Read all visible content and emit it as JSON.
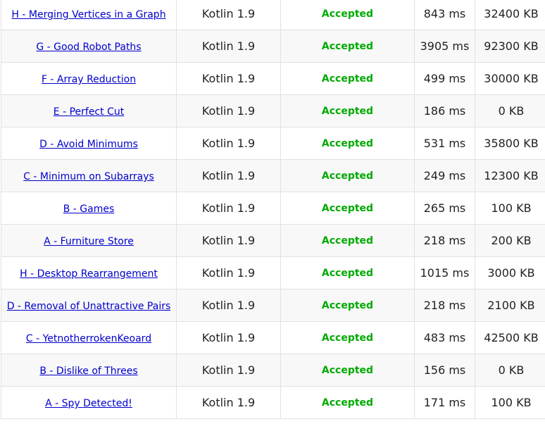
{
  "colors": {
    "link": "#0000cc",
    "accepted": "#00aa00",
    "row_alt": "#f8f8f8",
    "border": "#e1e1e1"
  },
  "rows": [
    {
      "problem": "H - Merging Vertices in a Graph",
      "lang": "Kotlin 1.9",
      "verdict": "Accepted",
      "time": "843 ms",
      "memory": "32400 KB"
    },
    {
      "problem": "G - Good Robot Paths",
      "lang": "Kotlin 1.9",
      "verdict": "Accepted",
      "time": "3905 ms",
      "memory": "92300 KB"
    },
    {
      "problem": "F - Array Reduction",
      "lang": "Kotlin 1.9",
      "verdict": "Accepted",
      "time": "499 ms",
      "memory": "30000 KB"
    },
    {
      "problem": "E - Perfect Cut",
      "lang": "Kotlin 1.9",
      "verdict": "Accepted",
      "time": "186 ms",
      "memory": "0 KB"
    },
    {
      "problem": "D - Avoid Minimums",
      "lang": "Kotlin 1.9",
      "verdict": "Accepted",
      "time": "531 ms",
      "memory": "35800 KB"
    },
    {
      "problem": "C - Minimum on Subarrays",
      "lang": "Kotlin 1.9",
      "verdict": "Accepted",
      "time": "249 ms",
      "memory": "12300 KB"
    },
    {
      "problem": "B - Games",
      "lang": "Kotlin 1.9",
      "verdict": "Accepted",
      "time": "265 ms",
      "memory": "100 KB"
    },
    {
      "problem": "A - Furniture Store",
      "lang": "Kotlin 1.9",
      "verdict": "Accepted",
      "time": "218 ms",
      "memory": "200 KB"
    },
    {
      "problem": "H - Desktop Rearrangement",
      "lang": "Kotlin 1.9",
      "verdict": "Accepted",
      "time": "1015 ms",
      "memory": "3000 KB"
    },
    {
      "problem": "D - Removal of Unattractive Pairs",
      "lang": "Kotlin 1.9",
      "verdict": "Accepted",
      "time": "218 ms",
      "memory": "2100 KB"
    },
    {
      "problem": "C - YetnotherrokenKeoard",
      "lang": "Kotlin 1.9",
      "verdict": "Accepted",
      "time": "483 ms",
      "memory": "42500 KB"
    },
    {
      "problem": "B - Dislike of Threes",
      "lang": "Kotlin 1.9",
      "verdict": "Accepted",
      "time": "156 ms",
      "memory": "0 KB"
    },
    {
      "problem": "A - Spy Detected!",
      "lang": "Kotlin 1.9",
      "verdict": "Accepted",
      "time": "171 ms",
      "memory": "100 KB"
    }
  ]
}
